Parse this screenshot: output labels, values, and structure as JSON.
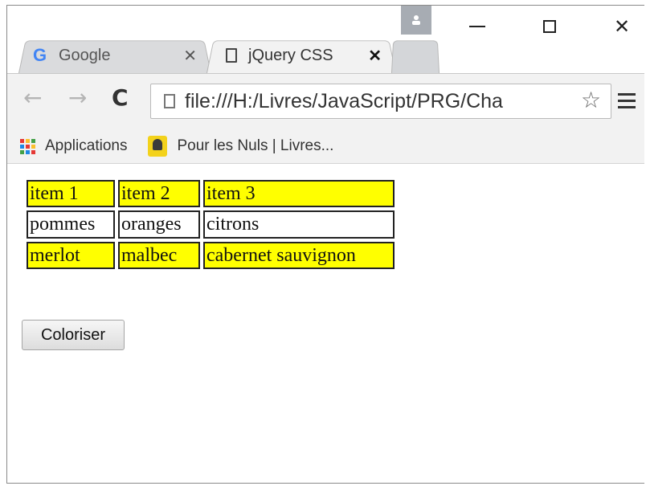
{
  "browser": {
    "tabs": [
      {
        "title": "Google",
        "active": false,
        "favicon": "google-g-icon"
      },
      {
        "title": "jQuery CSS",
        "active": true,
        "favicon": "document-icon"
      }
    ],
    "address_bar": {
      "url": "file:///H:/Livres/JavaScript/PRG/Cha"
    },
    "window_controls": {
      "minimize": "minimize-icon",
      "maximize": "maximize-icon",
      "close": "close-icon"
    },
    "bookmarks": [
      {
        "label": "Applications",
        "icon": "apps-grid-icon"
      },
      {
        "label": "Pour les Nuls | Livres...",
        "icon": "pour-les-nuls-icon"
      }
    ]
  },
  "page": {
    "table": {
      "rows": [
        {
          "style": "yellow",
          "cells": [
            "item 1",
            "item 2",
            "item 3"
          ]
        },
        {
          "style": "white",
          "cells": [
            "pommes",
            "oranges",
            "citrons"
          ]
        },
        {
          "style": "yellow",
          "cells": [
            "merlot",
            "malbec",
            "cabernet sauvignon"
          ]
        }
      ]
    },
    "button_label": "Coloriser"
  },
  "colors": {
    "highlight": "#ffff00",
    "toolbar_bg": "#f2f2f2",
    "google_blue": "#4285f4"
  }
}
